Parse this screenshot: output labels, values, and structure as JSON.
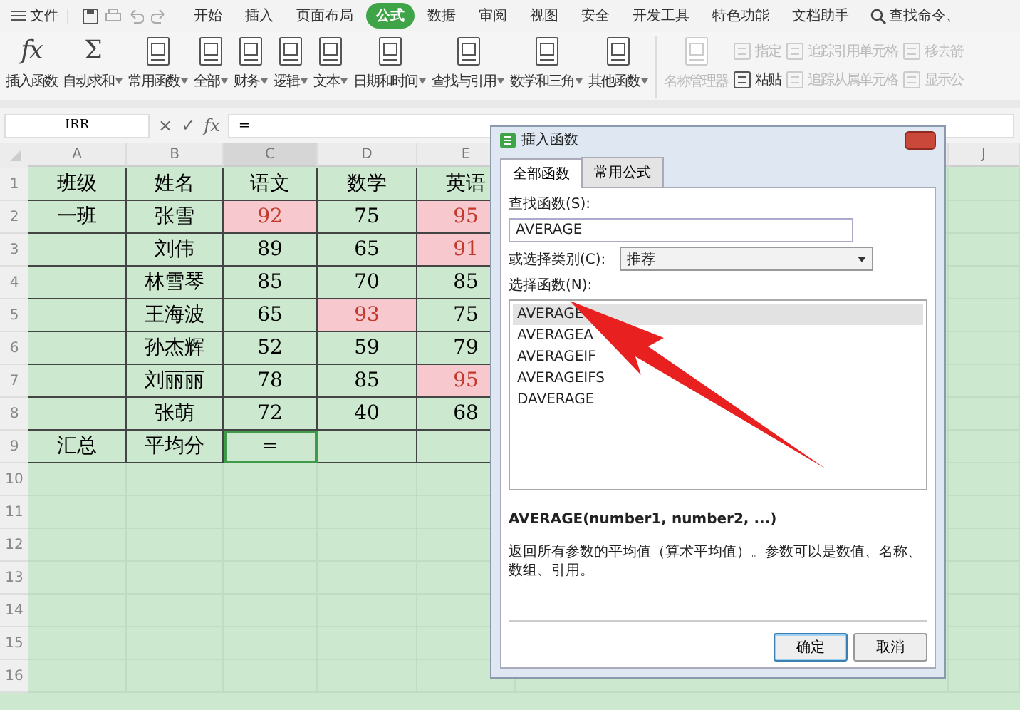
{
  "menu_bar": {
    "file_menu": "文件",
    "tabs": [
      {
        "label": "开始",
        "selected": false
      },
      {
        "label": "插入",
        "selected": false
      },
      {
        "label": "页面布局",
        "selected": false
      },
      {
        "label": "公式",
        "selected": true
      },
      {
        "label": "数据",
        "selected": false
      },
      {
        "label": "审阅",
        "selected": false
      },
      {
        "label": "视图",
        "selected": false
      },
      {
        "label": "安全",
        "selected": false
      },
      {
        "label": "开发工具",
        "selected": false
      },
      {
        "label": "特色功能",
        "selected": false
      },
      {
        "label": "文档助手",
        "selected": false
      }
    ],
    "search": "查找命令、"
  },
  "ribbon": {
    "large": [
      {
        "label": "插入函数",
        "kind": "fx",
        "glyph": "fx",
        "dropdown": false,
        "disabled": false
      },
      {
        "label": "自动求和",
        "kind": "sum",
        "glyph": "Σ",
        "dropdown": true,
        "disabled": false
      },
      {
        "label": "常用函数",
        "kind": "book",
        "dropdown": true,
        "disabled": false
      },
      {
        "label": "全部",
        "kind": "book",
        "dropdown": true,
        "disabled": false
      },
      {
        "label": "财务",
        "kind": "book",
        "dropdown": true,
        "disabled": false
      },
      {
        "label": "逻辑",
        "kind": "book",
        "dropdown": true,
        "disabled": false
      },
      {
        "label": "文本",
        "kind": "book",
        "dropdown": true,
        "disabled": false
      },
      {
        "label": "日期和时间",
        "kind": "book",
        "dropdown": true,
        "disabled": false
      },
      {
        "label": "查找与引用",
        "kind": "book",
        "dropdown": true,
        "disabled": false
      },
      {
        "label": "数学和三角",
        "kind": "book",
        "dropdown": true,
        "disabled": false
      },
      {
        "label": "其他函数",
        "kind": "book",
        "dropdown": true,
        "disabled": false
      },
      {
        "label": "名称管理器",
        "kind": "book",
        "dropdown": false,
        "disabled": true
      }
    ],
    "small_columns": [
      [
        {
          "label": "指定",
          "disabled": true
        },
        {
          "label": "粘贴",
          "disabled": false
        }
      ],
      [
        {
          "label": "追踪引用单元格",
          "disabled": true
        },
        {
          "label": "追踪从属单元格",
          "disabled": true
        }
      ],
      [
        {
          "label": "移去箭",
          "disabled": true
        },
        {
          "label": "显示公",
          "disabled": true
        }
      ]
    ]
  },
  "formula_bar": {
    "name_box": "IRR",
    "cancel": "×",
    "enter": "✓",
    "fx": "fx",
    "formula": "="
  },
  "sheet": {
    "columns": [
      "A",
      "B",
      "C",
      "D",
      "E",
      "J"
    ],
    "rows": [
      {
        "number": "1",
        "cells": [
          {
            "text": "班级",
            "highlight": false
          },
          {
            "text": "姓名",
            "highlight": false
          },
          {
            "text": "语文",
            "highlight": false
          },
          {
            "text": "数学",
            "highlight": false
          },
          {
            "text": "英语",
            "highlight": false
          }
        ]
      },
      {
        "number": "2",
        "cells": [
          {
            "text": "一班",
            "highlight": false
          },
          {
            "text": "张雪",
            "highlight": false
          },
          {
            "text": "92",
            "highlight": true
          },
          {
            "text": "75",
            "highlight": false
          },
          {
            "text": "95",
            "highlight": true
          }
        ]
      },
      {
        "number": "3",
        "cells": [
          {
            "text": "",
            "highlight": false
          },
          {
            "text": "刘伟",
            "highlight": false
          },
          {
            "text": "89",
            "highlight": false
          },
          {
            "text": "65",
            "highlight": false
          },
          {
            "text": "91",
            "highlight": true
          }
        ]
      },
      {
        "number": "4",
        "cells": [
          {
            "text": "",
            "highlight": false
          },
          {
            "text": "林雪琴",
            "highlight": false
          },
          {
            "text": "85",
            "highlight": false
          },
          {
            "text": "70",
            "highlight": false
          },
          {
            "text": "85",
            "highlight": false
          }
        ]
      },
      {
        "number": "5",
        "cells": [
          {
            "text": "",
            "highlight": false
          },
          {
            "text": "王海波",
            "highlight": false
          },
          {
            "text": "65",
            "highlight": false
          },
          {
            "text": "93",
            "highlight": true
          },
          {
            "text": "75",
            "highlight": false
          }
        ]
      },
      {
        "number": "6",
        "cells": [
          {
            "text": "",
            "highlight": false
          },
          {
            "text": "孙杰辉",
            "highlight": false
          },
          {
            "text": "52",
            "highlight": false
          },
          {
            "text": "59",
            "highlight": false
          },
          {
            "text": "79",
            "highlight": false
          }
        ]
      },
      {
        "number": "7",
        "cells": [
          {
            "text": "",
            "highlight": false
          },
          {
            "text": "刘丽丽",
            "highlight": false
          },
          {
            "text": "78",
            "highlight": false
          },
          {
            "text": "85",
            "highlight": false
          },
          {
            "text": "95",
            "highlight": true
          }
        ]
      },
      {
        "number": "8",
        "cells": [
          {
            "text": "",
            "highlight": false
          },
          {
            "text": "张萌",
            "highlight": false
          },
          {
            "text": "72",
            "highlight": false
          },
          {
            "text": "40",
            "highlight": false
          },
          {
            "text": "68",
            "highlight": false
          }
        ]
      },
      {
        "number": "9",
        "cells": [
          {
            "text": "汇总",
            "highlight": false
          },
          {
            "text": "平均分",
            "highlight": false
          },
          {
            "text": "=",
            "highlight": false,
            "selected": true
          },
          {
            "text": "",
            "highlight": false
          },
          {
            "text": "",
            "highlight": false
          }
        ]
      }
    ],
    "empty_rows": [
      "10",
      "11",
      "12",
      "13",
      "14",
      "15",
      "16"
    ]
  },
  "dialog": {
    "title": "插入函数",
    "tabs": [
      {
        "label": "全部函数",
        "selected": true
      },
      {
        "label": "常用公式",
        "selected": false
      }
    ],
    "search_label": "查找函数(S):",
    "search_value": "AVERAGE",
    "category_label": "或选择类别(C):",
    "category_value": "推荐",
    "list_label": "选择函数(N):",
    "functions": [
      {
        "name": "AVERAGE",
        "selected": true
      },
      {
        "name": "AVERAGEA",
        "selected": false
      },
      {
        "name": "AVERAGEIF",
        "selected": false
      },
      {
        "name": "AVERAGEIFS",
        "selected": false
      },
      {
        "name": "DAVERAGE",
        "selected": false
      }
    ],
    "signature": "AVERAGE(number1, number2, ...)",
    "description": "返回所有参数的平均值（算术平均值）。参数可以是数值、名称、数组、引用。",
    "buttons": [
      {
        "label": "确定",
        "default": true
      },
      {
        "label": "取消",
        "default": false
      }
    ]
  }
}
